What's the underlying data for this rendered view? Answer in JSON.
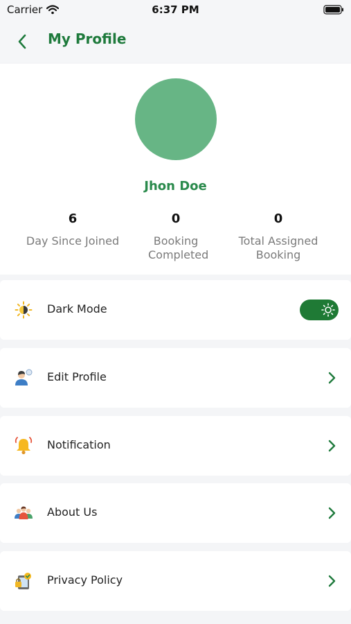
{
  "status_bar": {
    "carrier": "Carrier",
    "time": "6:37 PM"
  },
  "header": {
    "title": "My Profile"
  },
  "profile": {
    "name": "Jhon Doe",
    "stats": [
      {
        "value": "6",
        "label": "Day Since Joined"
      },
      {
        "value": "0",
        "label": "Booking Completed"
      },
      {
        "value": "0",
        "label": "Total Assigned Booking"
      }
    ]
  },
  "menu": {
    "dark_mode": {
      "label": "Dark Mode",
      "icon": "sun-moon-icon",
      "enabled": true
    },
    "items": [
      {
        "label": "Edit Profile",
        "icon": "user-edit-icon"
      },
      {
        "label": "Notification",
        "icon": "bell-icon"
      },
      {
        "label": "About Us",
        "icon": "people-icon"
      },
      {
        "label": "Privacy Policy",
        "icon": "privacy-lock-icon"
      }
    ]
  },
  "colors": {
    "primary": "#1e7a3c",
    "avatar": "#67b585",
    "background": "#f4f5f7"
  }
}
